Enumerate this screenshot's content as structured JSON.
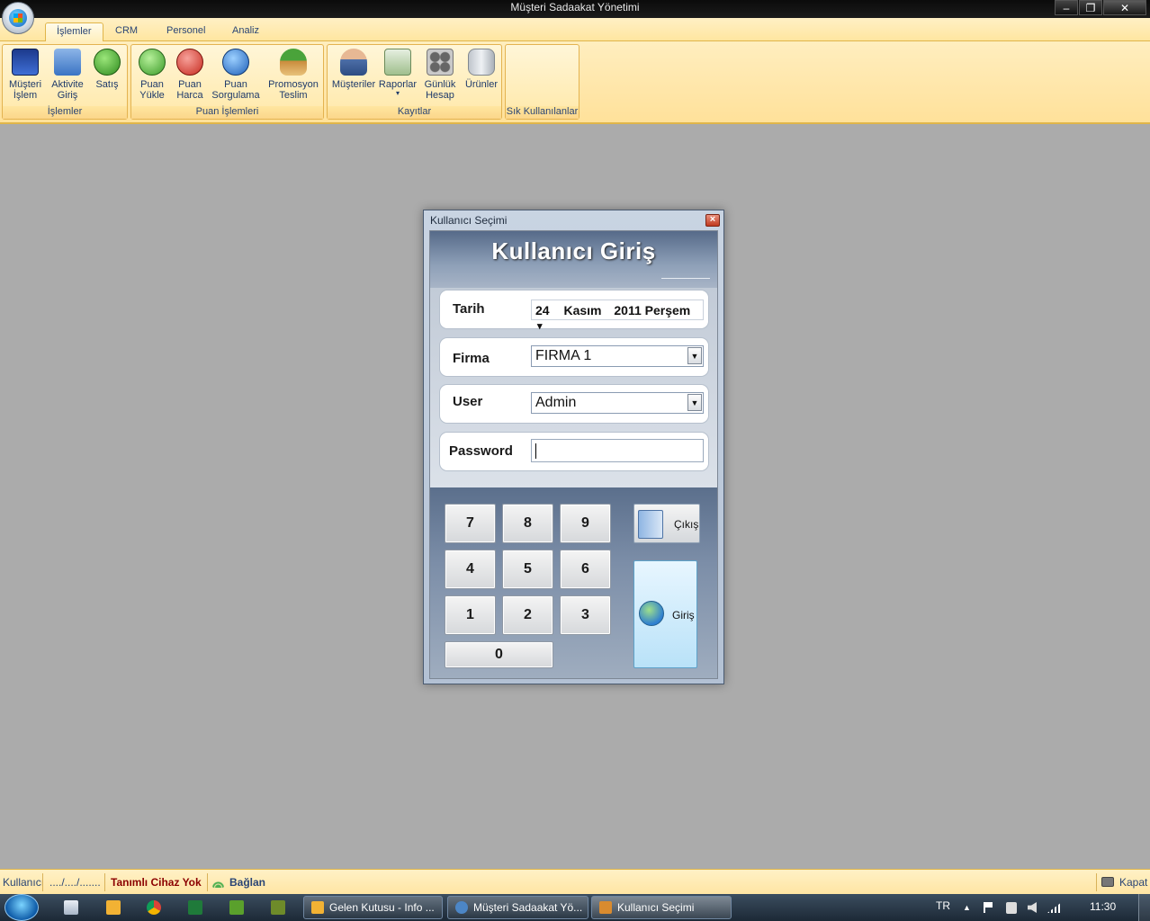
{
  "window": {
    "title": "Müşteri Sadaakat Yönetimi",
    "minimize": "–",
    "restore": "❐",
    "close": "✕"
  },
  "ribbon": {
    "tabs": [
      "İşlemler",
      "CRM",
      "Personel",
      "Analiz"
    ],
    "groups": {
      "islemler": {
        "label": "İşlemler",
        "buttons": [
          {
            "line1": "Müşteri",
            "line2": "İşlem"
          },
          {
            "line1": "Aktivite",
            "line2": "Giriş"
          },
          {
            "line1": "Satış",
            "line2": ""
          }
        ]
      },
      "puan": {
        "label": "Puan İşlemleri",
        "buttons": [
          {
            "line1": "Puan",
            "line2": "Yükle"
          },
          {
            "line1": "Puan",
            "line2": "Harca"
          },
          {
            "line1": "Puan",
            "line2": "Sorgulama"
          },
          {
            "line1": "Promosyon",
            "line2": "Teslim"
          }
        ]
      },
      "kayitlar": {
        "label": "Kayıtlar",
        "buttons": [
          {
            "line1": "Müşteriler",
            "line2": ""
          },
          {
            "line1": "Raporlar",
            "line2": "▾"
          },
          {
            "line1": "Günlük",
            "line2": "Hesap"
          },
          {
            "line1": "Ürünler",
            "line2": ""
          }
        ]
      },
      "sik": {
        "label": "Sık Kullanılanlar"
      }
    }
  },
  "dialog": {
    "title": "Kullanıcı Seçimi",
    "close": "×",
    "heading": "Kullanıcı Giriş",
    "fields": {
      "tarih": {
        "label": "Tarih",
        "day": "24",
        "month": "Kasım",
        "year_weekday": "2011 Perşem",
        "arrow": "▾"
      },
      "firma": {
        "label": "Firma",
        "value": "FIRMA 1",
        "arrow": "▼"
      },
      "user": {
        "label": "User",
        "value": "Admin",
        "arrow": "▼"
      },
      "password": {
        "label": "Password",
        "value": ""
      }
    },
    "keypad": [
      "7",
      "8",
      "9",
      "4",
      "5",
      "6",
      "1",
      "2",
      "3",
      "0"
    ],
    "exit_label": "Çıkış",
    "login_label": "Giriş"
  },
  "statusbar": {
    "user": "Kullanıcı",
    "date": "..../..../.......",
    "device": "Tanımlı Cihaz Yok",
    "connect": "Bağlan",
    "close": "Kapat"
  },
  "taskbar": {
    "tasks": [
      {
        "label": "Gelen Kutusu - Info ...",
        "icon_color": "#f2b234"
      },
      {
        "label": "Müşteri Sadaakat Yö...",
        "icon_color": "#4c86c6"
      },
      {
        "label": "Kullanıcı Seçimi",
        "icon_color": "#d98b2f"
      }
    ],
    "lang": "TR",
    "clock": "11:30"
  },
  "colors": {
    "ribbon": "#ffe6a0",
    "background": "#ababab",
    "device_text": "#8b0000",
    "taskbar": "#1c2936"
  }
}
